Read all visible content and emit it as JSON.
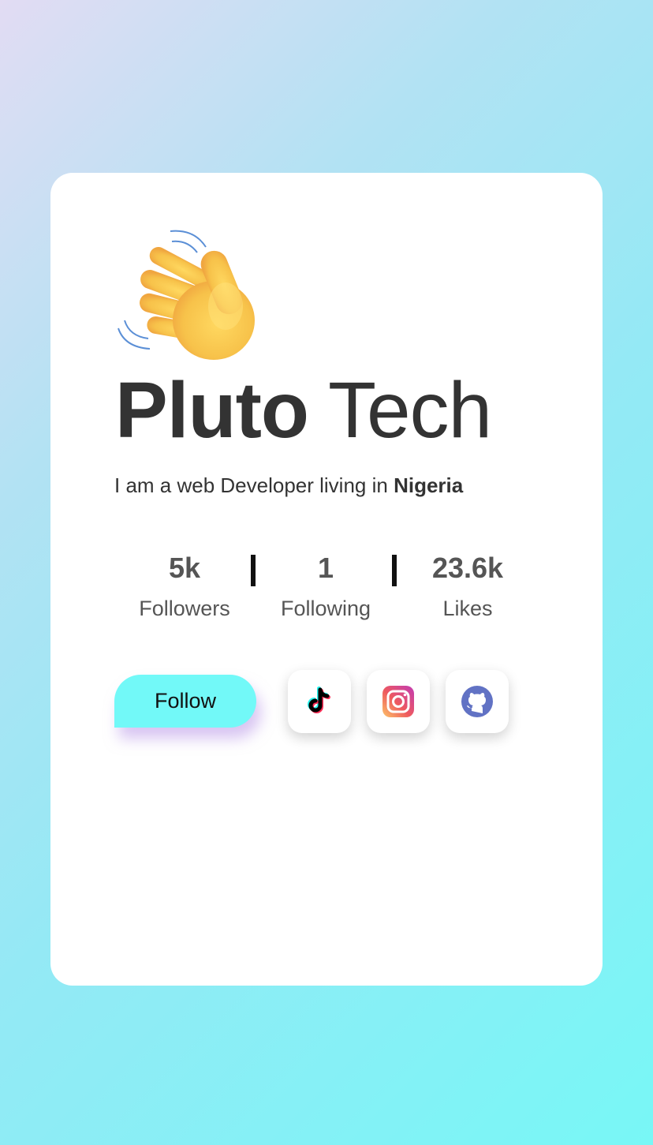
{
  "profile": {
    "name_bold": "Pluto",
    "name_light": "Tech",
    "bio_prefix": "I am a web Developer living in ",
    "bio_location": "Nigeria"
  },
  "stats": [
    {
      "value": "5k",
      "label": "Followers"
    },
    {
      "value": "1",
      "label": "Following"
    },
    {
      "value": "23.6k",
      "label": "Likes"
    }
  ],
  "actions": {
    "follow_label": "Follow"
  },
  "socials": [
    {
      "icon": "tiktok-icon"
    },
    {
      "icon": "instagram-icon"
    },
    {
      "icon": "github-icon"
    }
  ],
  "colors": {
    "follow_button": "#72f9f8",
    "github": "#6172c4",
    "text": "#333333"
  }
}
